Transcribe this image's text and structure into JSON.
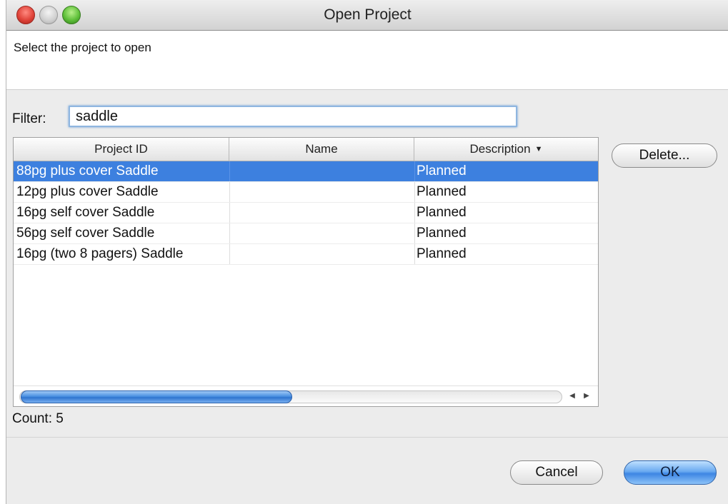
{
  "window": {
    "title": "Open Project"
  },
  "header": {
    "instruction": "Select the project to open"
  },
  "filter": {
    "label": "Filter:",
    "value": "saddle"
  },
  "table": {
    "columns": [
      "Project ID",
      "Name",
      "Description"
    ],
    "sort_indicator": "▼",
    "rows": [
      {
        "project_id": "88pg plus cover Saddle",
        "name": "",
        "description": "Planned",
        "selected": true
      },
      {
        "project_id": "12pg plus cover Saddle",
        "name": "",
        "description": "Planned",
        "selected": false
      },
      {
        "project_id": "16pg self cover Saddle",
        "name": "",
        "description": "Planned",
        "selected": false
      },
      {
        "project_id": "56pg self cover Saddle",
        "name": "",
        "description": "Planned",
        "selected": false
      },
      {
        "project_id": "16pg (two 8 pagers) Saddle",
        "name": "",
        "description": "Planned",
        "selected": false
      }
    ]
  },
  "buttons": {
    "delete": "Delete...",
    "cancel": "Cancel",
    "ok": "OK"
  },
  "status": {
    "count": "Count: 5"
  },
  "scroll": {
    "left_arrow": "◀",
    "right_arrow": "▶"
  }
}
